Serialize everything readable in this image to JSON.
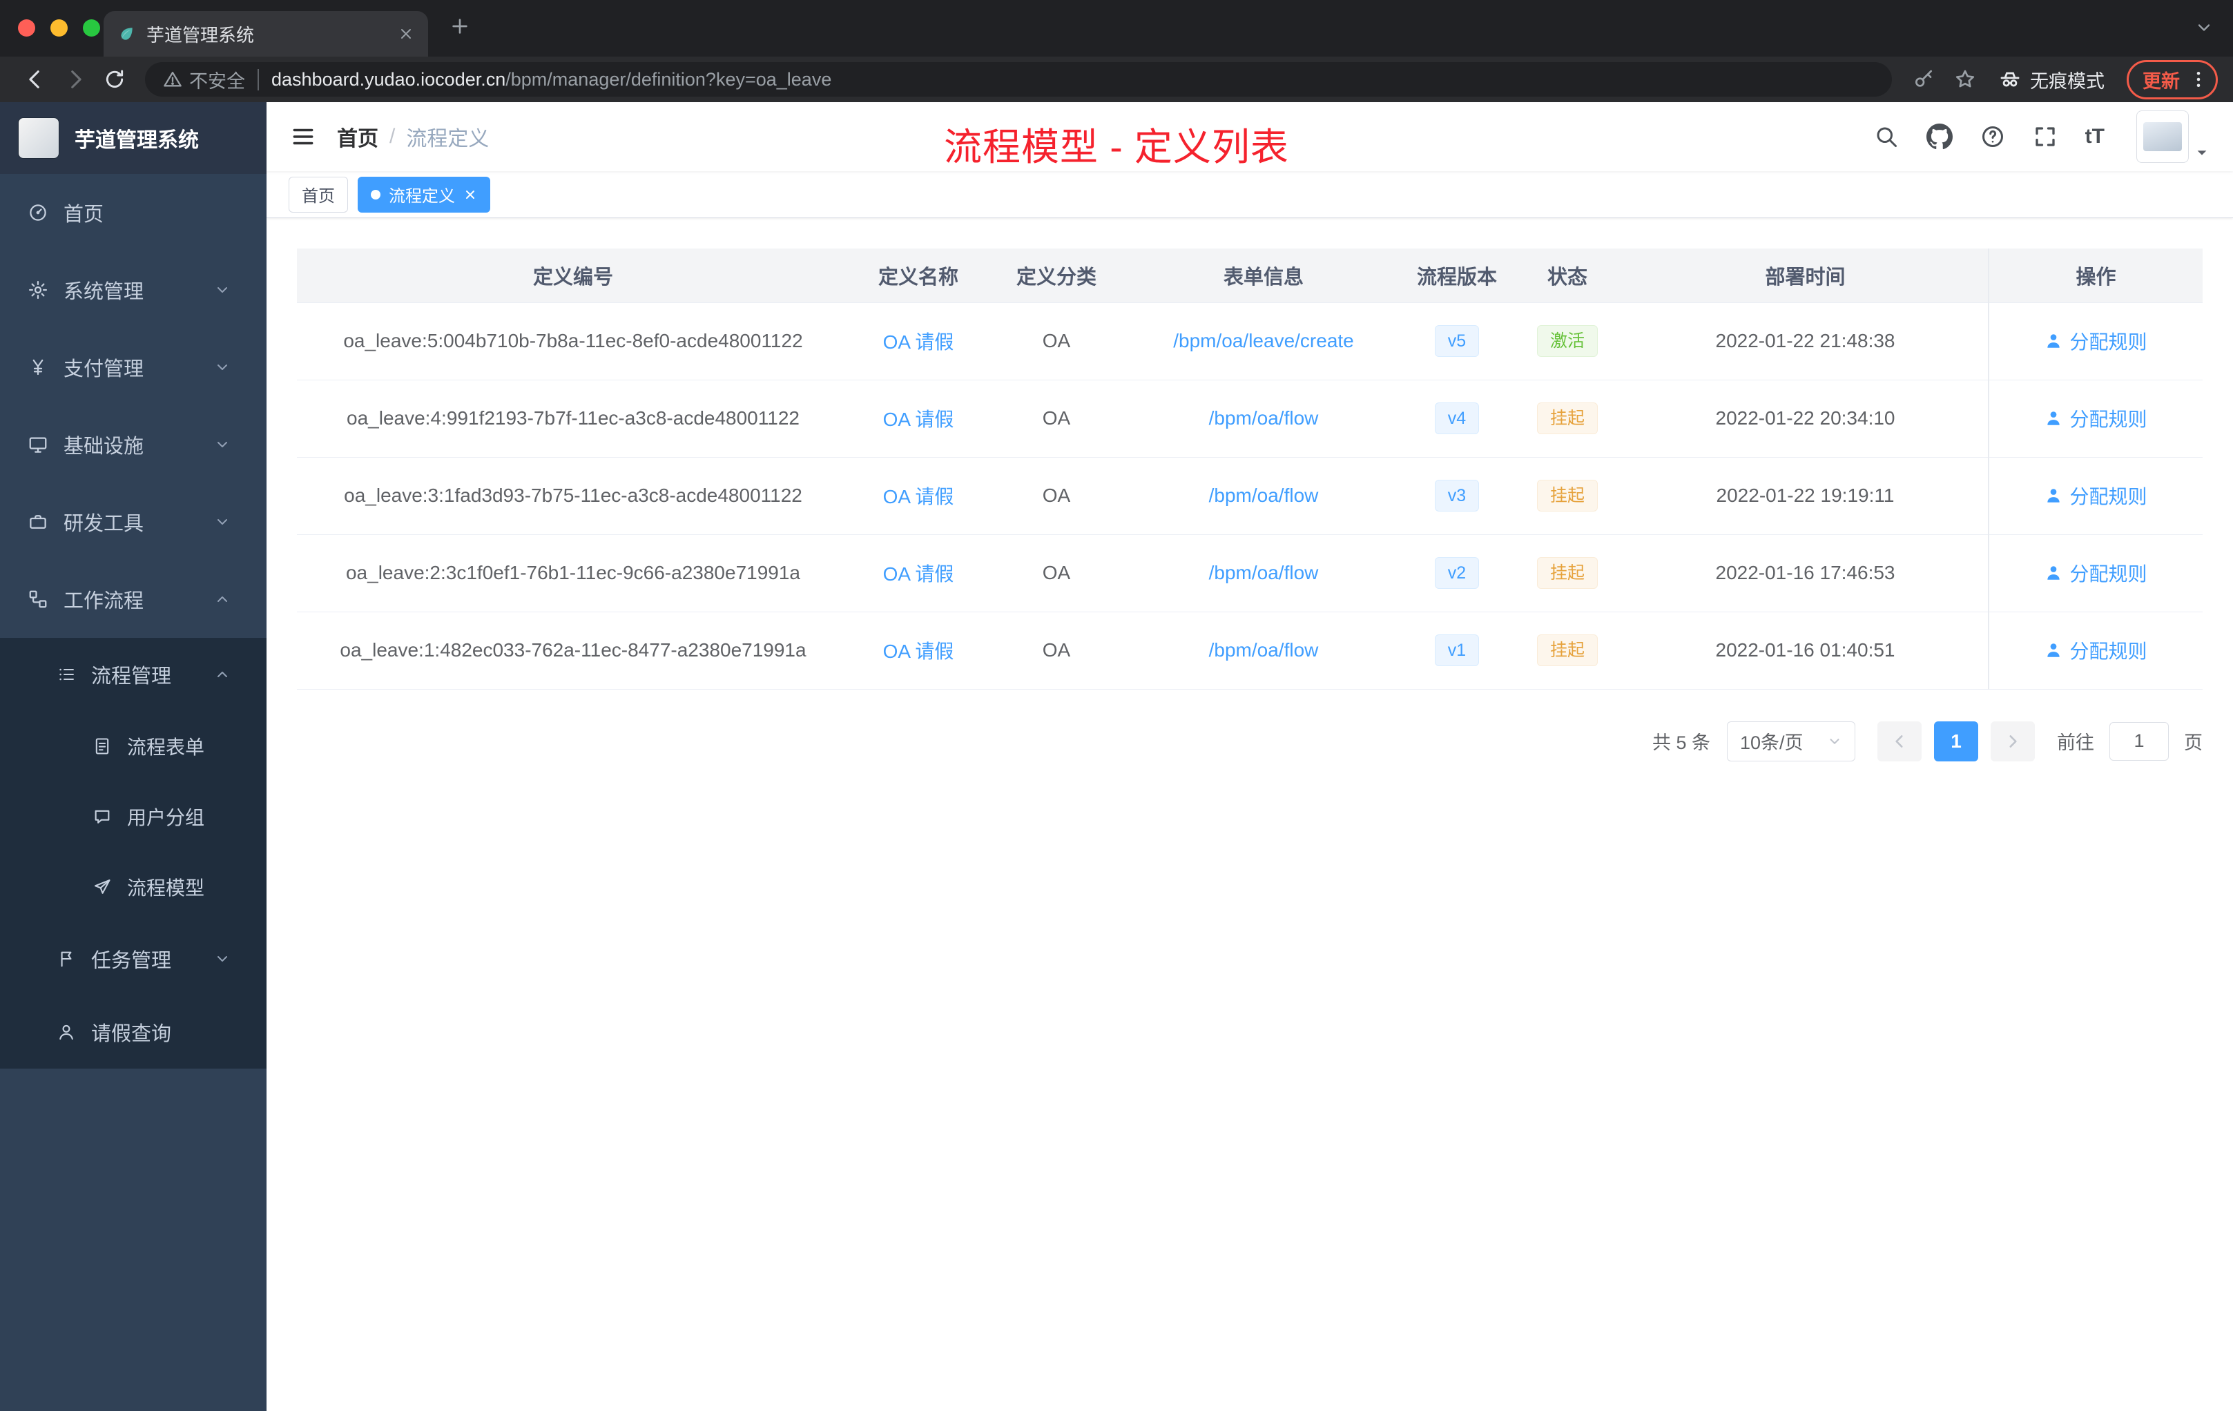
{
  "browser": {
    "tab_title": "芋道管理系统",
    "security_label": "不安全",
    "url_host": "dashboard.yudao.iocoder.cn",
    "url_path": "/bpm/manager/definition?key=oa_leave",
    "incognito_label": "无痕模式",
    "update_label": "更新"
  },
  "sidebar": {
    "logo_title": "芋道管理系统",
    "items": [
      {
        "label": "首页"
      },
      {
        "label": "系统管理"
      },
      {
        "label": "支付管理"
      },
      {
        "label": "基础设施"
      },
      {
        "label": "研发工具"
      },
      {
        "label": "工作流程"
      }
    ],
    "process_group": "流程管理",
    "process_children": [
      {
        "label": "流程表单"
      },
      {
        "label": "用户分组"
      },
      {
        "label": "流程模型"
      }
    ],
    "task_group": "任务管理",
    "leave_query": "请假查询"
  },
  "header": {
    "breadcrumb_home": "首页",
    "breadcrumb_sep": "/",
    "breadcrumb_current": "流程定义",
    "annotation": "流程模型 - 定义列表",
    "font_icon_label": "tT"
  },
  "tags": {
    "home": "首页",
    "current": "流程定义"
  },
  "table": {
    "headers": [
      "定义编号",
      "定义名称",
      "定义分类",
      "表单信息",
      "流程版本",
      "状态",
      "部署时间",
      "操作"
    ],
    "rows": [
      {
        "id": "oa_leave:5:004b710b-7b8a-11ec-8ef0-acde48001122",
        "name": "OA 请假",
        "category": "OA",
        "form": "/bpm/oa/leave/create",
        "version": "v5",
        "status": "激活",
        "deploy_time": "2022-01-22 21:48:38",
        "action": "分配规则"
      },
      {
        "id": "oa_leave:4:991f2193-7b7f-11ec-a3c8-acde48001122",
        "name": "OA 请假",
        "category": "OA",
        "form": "/bpm/oa/flow",
        "version": "v4",
        "status": "挂起",
        "deploy_time": "2022-01-22 20:34:10",
        "action": "分配规则"
      },
      {
        "id": "oa_leave:3:1fad3d93-7b75-11ec-a3c8-acde48001122",
        "name": "OA 请假",
        "category": "OA",
        "form": "/bpm/oa/flow",
        "version": "v3",
        "status": "挂起",
        "deploy_time": "2022-01-22 19:19:11",
        "action": "分配规则"
      },
      {
        "id": "oa_leave:2:3c1f0ef1-76b1-11ec-9c66-a2380e71991a",
        "name": "OA 请假",
        "category": "OA",
        "form": "/bpm/oa/flow",
        "version": "v2",
        "status": "挂起",
        "deploy_time": "2022-01-16 17:46:53",
        "action": "分配规则"
      },
      {
        "id": "oa_leave:1:482ec033-762a-11ec-8477-a2380e71991a",
        "name": "OA 请假",
        "category": "OA",
        "form": "/bpm/oa/flow",
        "version": "v1",
        "status": "挂起",
        "deploy_time": "2022-01-16 01:40:51",
        "action": "分配规则"
      }
    ]
  },
  "pagination": {
    "total": "共 5 条",
    "page_size": "10条/页",
    "page": "1",
    "goto_label": "前往",
    "goto_value": "1",
    "page_unit": "页"
  },
  "colors": {
    "accent_blue": "#409eff",
    "annotation_red": "#f5222d",
    "status_active_green": "#67c23a",
    "status_suspend_orange": "#e6a23c",
    "sidebar_bg": "#304156",
    "submenu_bg": "#1f2d3d"
  }
}
